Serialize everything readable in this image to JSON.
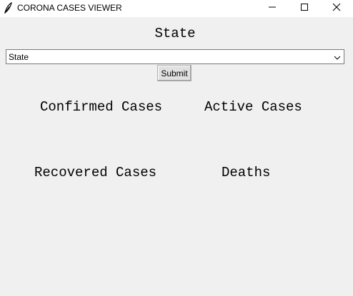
{
  "window": {
    "title": "CORONA CASES VIEWER",
    "icons": {
      "app": "feather-icon",
      "minimize": "minimize-icon",
      "maximize": "maximize-icon",
      "close": "close-icon"
    }
  },
  "form": {
    "heading": "State",
    "state_select": {
      "value": "State",
      "arrow_icon": "chevron-down-icon"
    },
    "submit_label": "Submit"
  },
  "stats": {
    "confirmed_label": "Confirmed Cases",
    "active_label": "Active Cases",
    "recovered_label": "Recovered Cases",
    "deaths_label": "Deaths"
  }
}
